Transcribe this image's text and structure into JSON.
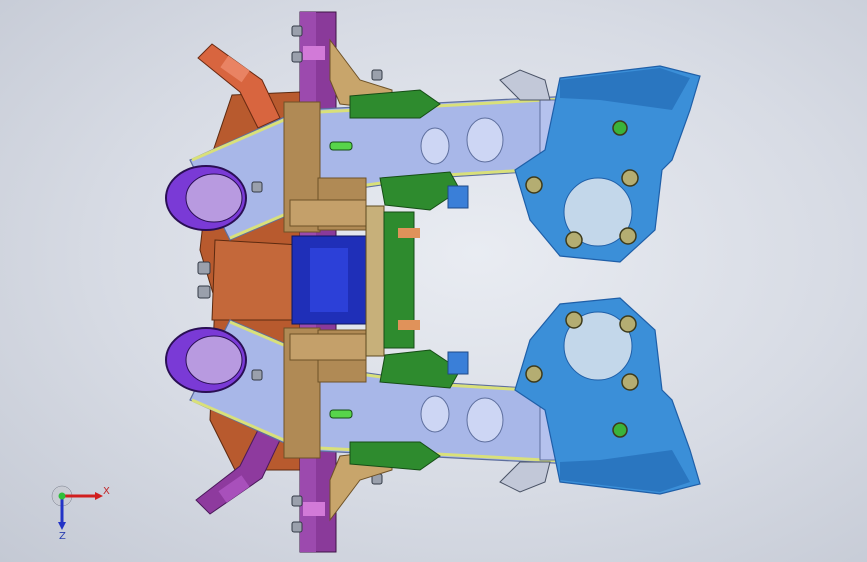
{
  "viewport": {
    "background": "#d7dbe4"
  },
  "triad": {
    "x_label": "X",
    "z_label": "Z",
    "x_color": "#d11f1f",
    "y_color": "#2fbf3a",
    "z_color": "#2233c6"
  },
  "model": {
    "part_colors": {
      "frame": "#a8b7e8",
      "frame_dark": "#5e6f9e",
      "outline": "#d9e07a",
      "knuckle": "#3b8fd8",
      "knuckle_dark": "#1f5fa8",
      "block": "#b08a55",
      "block_dark": "#6e5228",
      "plate": "#8a3a9a",
      "base": "#b85a2e",
      "base_dark": "#7a3415",
      "clamp": "#7a3ad6",
      "jaw": "#e06d4a",
      "center": "#1f2fb8",
      "green": "#2e8b2e",
      "bolt": "#c9c08a"
    }
  }
}
